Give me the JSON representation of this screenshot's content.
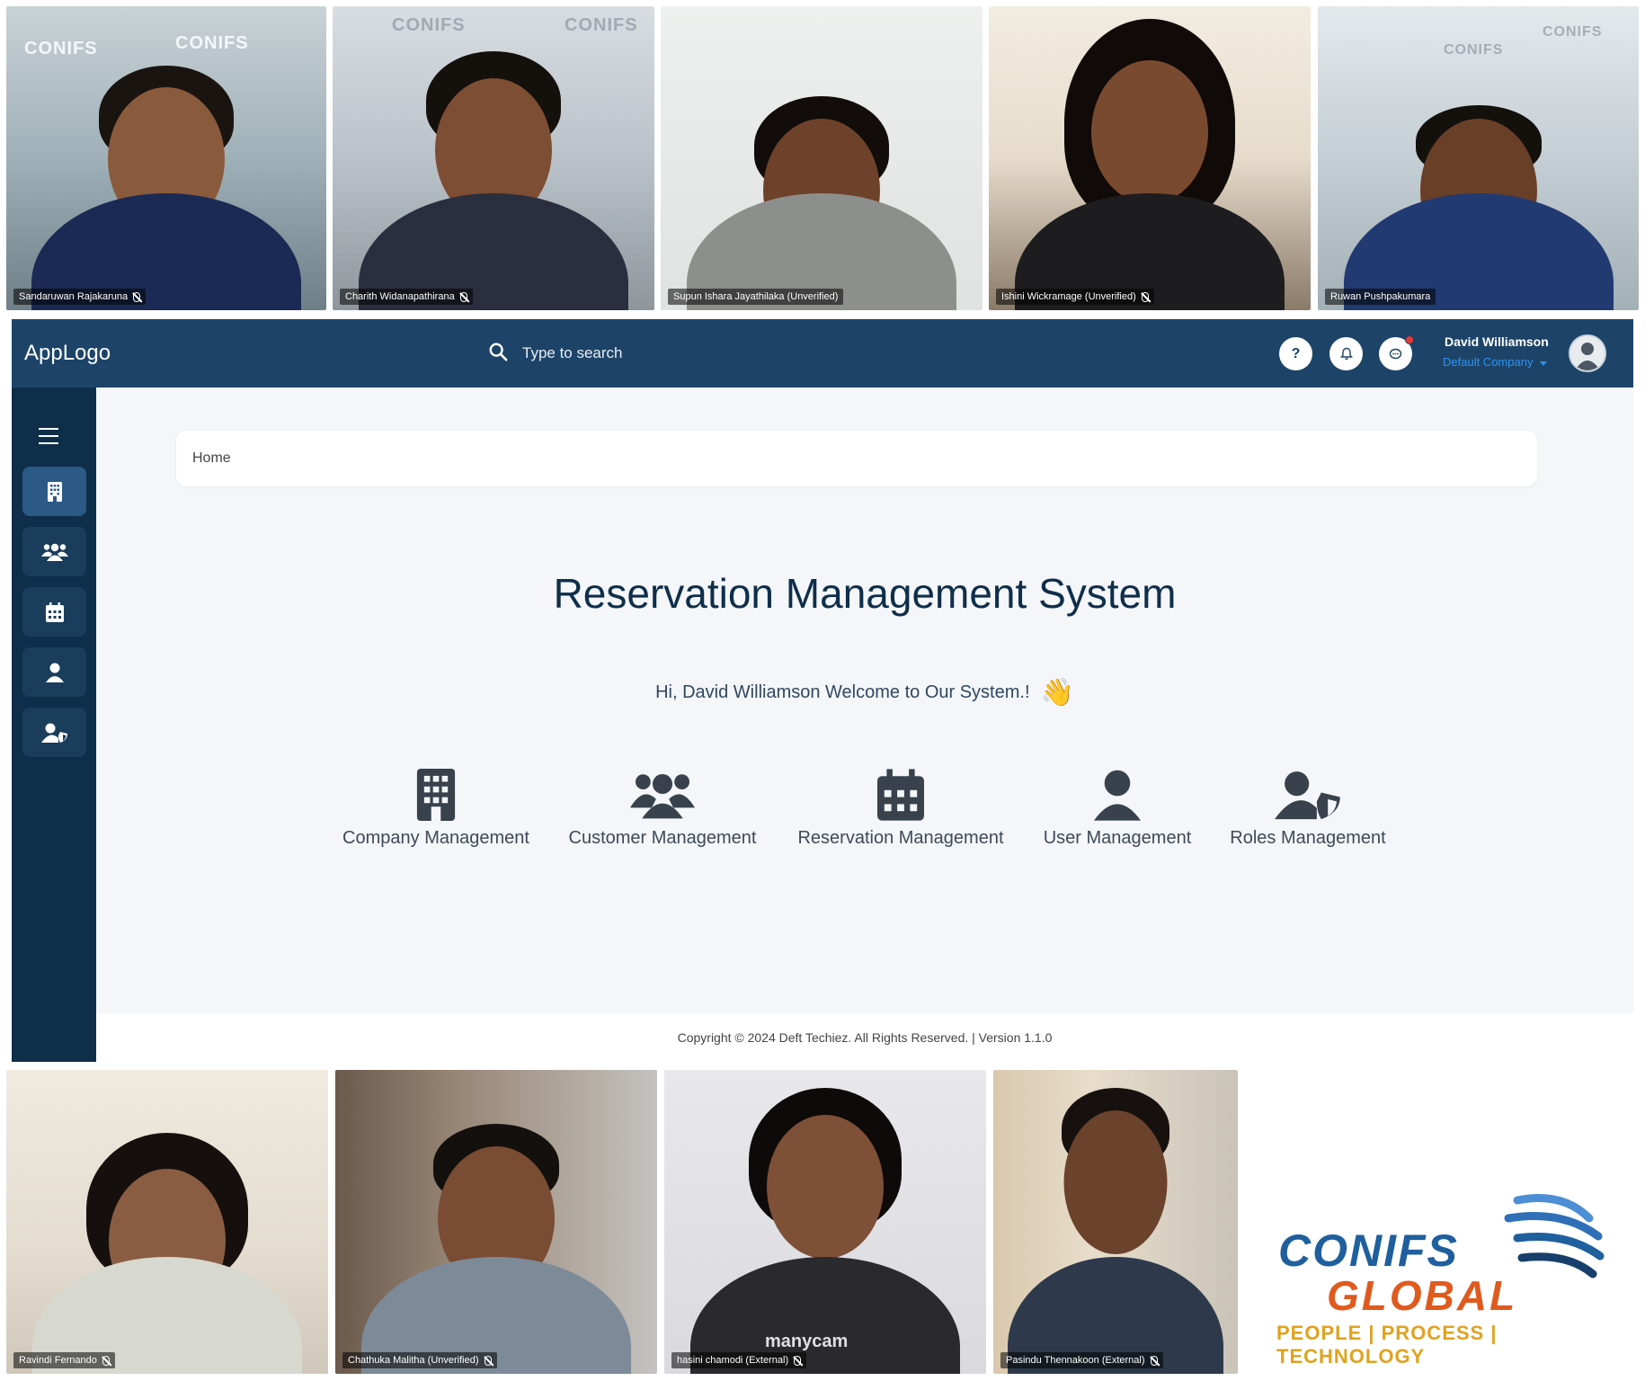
{
  "participants_top": [
    {
      "name": "Sandaruwan Rajakaruna"
    },
    {
      "name": "Charith Widanapathirana"
    },
    {
      "name": "Supun Ishara Jayathilaka (Unverified)"
    },
    {
      "name": "Ishini Wickramage (Unverified)"
    },
    {
      "name": "Ruwan Pushpakumara"
    }
  ],
  "participants_bottom": [
    {
      "name": "Ravindi Fernando"
    },
    {
      "name": "Chathuka Malitha (Unverified)"
    },
    {
      "name": "hasini chamodi (External)"
    },
    {
      "name": "Pasindu Thennakoon (External)"
    }
  ],
  "watermark": {
    "text": "CONIFS",
    "text2": "GLOBAL",
    "manycam": "manycam"
  },
  "app": {
    "logo": "AppLogo",
    "search_placeholder": "Type to search",
    "help_label": "?",
    "user_name": "David Williamson",
    "company": "Default Company",
    "breadcrumb": "Home",
    "title": "Reservation Management System",
    "welcome": "Hi, David Williamson Welcome to Our System.!",
    "welcome_emoji": "👋",
    "modules": [
      {
        "label": "Company Management",
        "icon": "building-icon"
      },
      {
        "label": "Customer Management",
        "icon": "users-icon"
      },
      {
        "label": "Reservation Management",
        "icon": "calendar-icon"
      },
      {
        "label": "User Management",
        "icon": "user-icon"
      },
      {
        "label": "Roles Management",
        "icon": "user-shield-icon"
      }
    ],
    "footer": "Copyright © 2024 Deft Techiez. All Rights Reserved. | Version 1.1.0",
    "colors": {
      "topbar": "#1d4468",
      "sidebar": "#0f2e4a",
      "title": "#0f2e4a"
    }
  },
  "brand": {
    "line1": "CONIFS",
    "line2": "GLOBAL",
    "tagline": "PEOPLE | PROCESS | TECHNOLOGY"
  }
}
